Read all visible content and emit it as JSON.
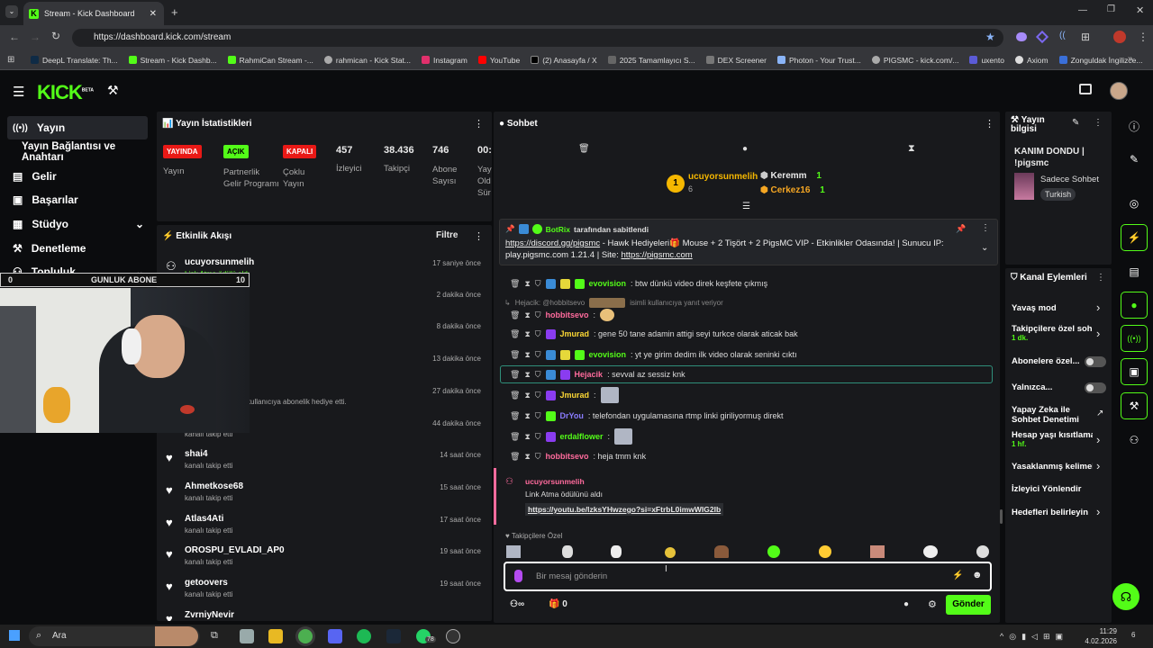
{
  "browser": {
    "tab_title": "Stream - Kick Dashboard",
    "url": "https://dashboard.kick.com/stream",
    "bookmarks": [
      "DeepL Translate: Th...",
      "Stream - Kick Dashb...",
      "RahmiCan Stream -...",
      "rahmican - Kick Stat...",
      "Instagram",
      "YouTube",
      "(2) Anasayfa / X",
      "2025 Tamamlayıcı S...",
      "DEX Screener",
      "Photon - Your Trust...",
      "PIGSMC - kick.com/...",
      "uxento",
      "Axiom",
      "Zonguldak İngilizce..."
    ]
  },
  "logo": "KICK",
  "logo_beta": "BETA",
  "sidebar": {
    "items": [
      "Yayın",
      "Yayın Bağlantısı ve Anahtarı",
      "Gelir",
      "Başarılar",
      "Stüdyo",
      "Denetleme",
      "Topluluk"
    ]
  },
  "overlay": {
    "left": "0",
    "label": "GUNLUK ABONE",
    "right": "10"
  },
  "stats": {
    "title": "Yayın İstatistikleri",
    "badges": [
      {
        "label": "YAYINDA",
        "sub": "Yayın",
        "color": "#e91916"
      },
      {
        "label": "AÇIK",
        "sub": "Partnerlik Gelir Programı",
        "color": "#53fc18"
      },
      {
        "label": "KAPALI",
        "sub": "Çoklu Yayın",
        "color": "#e91916"
      }
    ],
    "numbers": [
      {
        "value": "457",
        "label": "İzleyici"
      },
      {
        "value": "38.436",
        "label": "Takipçi"
      },
      {
        "value": "746",
        "label": "Abone Sayısı"
      },
      {
        "value": "00:",
        "label": "Yay Old Sür"
      }
    ]
  },
  "activity": {
    "title": "Etkinlik Akışı",
    "filter": "Filtre",
    "items": [
      {
        "name": "ucuyorsunmelih",
        "sub": "Link Atma ödülü aldı",
        "time": "17 saniye önce"
      },
      {
        "name": "",
        "sub": "",
        "time": "2 dakika önce"
      },
      {
        "name": "",
        "sub": "",
        "time": "8 dakika önce"
      },
      {
        "name": "",
        "sub": "",
        "time": "13 dakika önce"
      },
      {
        "name": "",
        "sub": "kullanıcıya abonelik hediye etti.",
        "time": "27 dakika önce"
      },
      {
        "name": "",
        "sub": "kanalı takip etti",
        "time": "44 dakika önce"
      },
      {
        "name": "shai4",
        "sub": "kanalı takip etti",
        "time": "14 saat önce"
      },
      {
        "name": "Ahmetkose68",
        "sub": "kanalı takip etti",
        "time": "15 saat önce"
      },
      {
        "name": "Atlas4Ati",
        "sub": "kanalı takip etti",
        "time": "17 saat önce"
      },
      {
        "name": "OROSPU_EVLADI_AP0",
        "sub": "kanalı takip etti",
        "time": "19 saat önce"
      },
      {
        "name": "getoovers",
        "sub": "kanalı takip etti",
        "time": "19 saat önce"
      },
      {
        "name": "ZvrniyNevir",
        "sub": "",
        "time": ""
      }
    ]
  },
  "chat": {
    "title": "Sohbet",
    "leader": {
      "name": "ucuyorsunmelih",
      "count": "6",
      "rank": "1"
    },
    "leaders2": [
      {
        "name": "Keremm",
        "count": "1"
      },
      {
        "name": "Cerkez16",
        "count": "1"
      }
    ],
    "pinned": {
      "by": "BotRix",
      "by_suffix": "tarafından sabitlendi",
      "link1": "https://discord.gg/pigsmc",
      "text": " - Hawk Hediyeleri🎁 Mouse + 2 Tişört + 2 PigsMC VIP - Etkinlikler Odasında! | Sunucu IP: play.pigsmc.com 1.21.4 | Site: ",
      "link2": "https://pigsmc.com"
    },
    "messages": [
      {
        "user": "evovision",
        "color": "#53fc18",
        "text": ": btw dünkü video direk keşfete çıkmış"
      },
      {
        "user": "hobbitsevo",
        "color": "#ff6b9d",
        "text": ":"
      },
      {
        "user": "Jmurad",
        "color": "#fdd835",
        "text": ": gene 50 tane adamin attigi seyi turkce olarak aticak bak"
      },
      {
        "user": "evovision",
        "color": "#53fc18",
        "text": ": yt ye girim dedim ilk video olarak seninki cıktı"
      },
      {
        "user": "Hejacik",
        "color": "#ff6b9d",
        "text": ": sevval az sessiz knk"
      },
      {
        "user": "Jmurad",
        "color": "#fdd835",
        "text": ":"
      },
      {
        "user": "DrYou",
        "color": "#8a7cff",
        "text": ": telefondan uygulamasına rtmp linki giriliyormuş direkt"
      },
      {
        "user": "erdalflower",
        "color": "#53fc18",
        "text": ":"
      },
      {
        "user": "hobbitsevo",
        "color": "#ff6b9d",
        "text": ": heja tmm knk"
      }
    ],
    "reply_note": "Hejacik: @hobbitsevo",
    "reply_suffix": "isimli kullanıcıya yanıt veriyor",
    "reward": {
      "user": "ucuyorsunmelih",
      "text": "Link Atma ödülünü aldı",
      "link": "https://youtu.be/lzksYHwzego?si=xFtrbL0imwWIG2Ib"
    },
    "emote_label": "Takipçilere Özel",
    "input_placeholder": "Bir mesaj gönderin",
    "send": "Gönder",
    "count": "0"
  },
  "stream_info": {
    "title": "Yayın bilgisi",
    "name": "KANIM DONDU | !pigsmc",
    "category": "Sadece Sohbet",
    "tag": "Turkish"
  },
  "channel_actions": {
    "title": "Kanal Eylemleri",
    "items": [
      {
        "label": "Yavaş mod",
        "sub": ""
      },
      {
        "label": "Takipçilere özel soh",
        "sub": "1 dk."
      },
      {
        "label": "Abonelere özel...",
        "sub": ""
      },
      {
        "label": "Yalnızca...",
        "sub": ""
      },
      {
        "label": "Yapay Zeka ile Sohbet Denetimi",
        "sub": ""
      },
      {
        "label": "Hesap yaşı kısıtlama",
        "sub": "1 hf."
      },
      {
        "label": "Yasaklanmış kelimel",
        "sub": ""
      },
      {
        "label": "İzleyici Yönlendir",
        "sub": ""
      },
      {
        "label": "Hedefleri belirleyin",
        "sub": ""
      }
    ]
  },
  "taskbar": {
    "search": "Ara",
    "badge": "78",
    "time": "11:29",
    "date": "4.02.2026",
    "notif": "6"
  }
}
